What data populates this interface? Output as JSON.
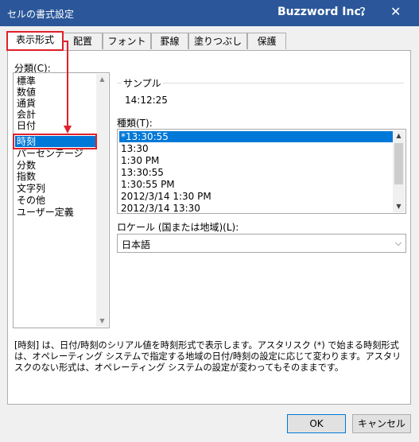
{
  "window": {
    "title": "セルの書式設定",
    "company": "Buzzword Inc.",
    "help_glyph": "?",
    "close_glyph": "✕"
  },
  "tabs": [
    {
      "label": "表示形式",
      "active": true
    },
    {
      "label": "配置"
    },
    {
      "label": "フォント"
    },
    {
      "label": "罫線"
    },
    {
      "label": "塗りつぶし"
    },
    {
      "label": "保護"
    }
  ],
  "category": {
    "label": "分類(C):",
    "items": [
      "標準",
      "数値",
      "通貨",
      "会計",
      "日付",
      "時刻",
      "パーセンテージ",
      "分数",
      "指数",
      "文字列",
      "その他",
      "ユーザー定義"
    ],
    "selected": "時刻"
  },
  "sample": {
    "label": "サンプル",
    "value": "14:12:25"
  },
  "type": {
    "label": "種類(T):",
    "items": [
      "*13:30:55",
      "13:30",
      "1:30 PM",
      "13:30:55",
      "1:30:55 PM",
      "2012/3/14 1:30 PM",
      "2012/3/14 13:30"
    ],
    "selected": "*13:30:55"
  },
  "locale": {
    "label": "ロケール (国または地域)(L):",
    "value": "日本語"
  },
  "description": "[時刻] は、日付/時刻のシリアル値を時刻形式で表示します。アスタリスク (*) で始まる時刻形式は、オペレーティング システムで指定する地域の日付/時刻の設定に応じて変わります。アスタリスクのない形式は、オペレーティング システムの設定が変わってもそのままです。",
  "buttons": {
    "ok": "OK",
    "cancel": "キャンセル"
  },
  "annotation_color": "#e0202a",
  "selection_color": "#0078d7"
}
